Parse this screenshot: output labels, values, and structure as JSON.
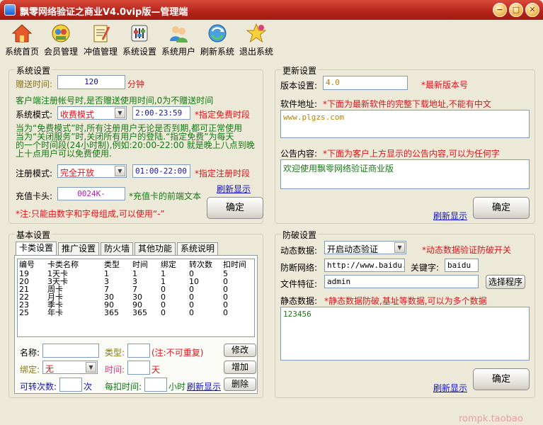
{
  "window": {
    "title": "飘零网络验证之商业V4.0vip版—管理端",
    "btn_min": "−",
    "btn_max": "□",
    "btn_close": "✕"
  },
  "toolbar": [
    {
      "label": "系统首页",
      "icon": "home-icon"
    },
    {
      "label": "会员管理",
      "icon": "members-icon"
    },
    {
      "label": "冲值管理",
      "icon": "recharge-icon"
    },
    {
      "label": "系统设置",
      "icon": "settings-icon"
    },
    {
      "label": "系统用户",
      "icon": "users-icon"
    },
    {
      "label": "刷新系统",
      "icon": "refresh-icon"
    },
    {
      "label": "退出系统",
      "icon": "exit-icon"
    }
  ],
  "system_settings": {
    "title": "系统设置",
    "gift_time_label": "赠送时间:",
    "gift_time_value": "120",
    "gift_time_unit": "分钟",
    "gift_hint": "客户端注册帐号时,是否赠送使用时间,0为不赠送时间",
    "mode_label": "系统模式:",
    "mode_value": "收费模式",
    "free_period_value": "2:00-23:59",
    "free_period_hint": "*指定免费时段",
    "mode_desc_1": "当为“免费模式”时,所有注册用户无论是否到期,都可正常使用",
    "mode_desc_2": "当为“关闭服务”时,关闭所有用户的登陆.“指定免费”为每天",
    "mode_desc_3": "的一个时间段(24小时制),例如:20:00-22:00 就是晚上八点到晚",
    "mode_desc_4": "上十点用户可以免费使用.",
    "reg_mode_label": "注册模式:",
    "reg_mode_value": "完全开放",
    "reg_period_value": "01:00-22:00",
    "reg_period_hint": "*指定注册时段",
    "card_prefix_label": "充值卡头:",
    "card_prefix_value": "0024K-",
    "card_prefix_hint": "*充值卡的前端文本",
    "refresh_link": "刷新显示",
    "note": "*注:只能由数字和字母组成,可以使用“-”",
    "ok_button": "确定"
  },
  "update_settings": {
    "title": "更新设置",
    "version_label": "版本设置:",
    "version_value": "4.0",
    "version_hint": "*最新版本号",
    "url_label": "软件地址:",
    "url_hint": "*下面为最新软件的完整下载地址,不能有中文",
    "url_value": "www.plgzs.com",
    "notice_label": "公告内容:",
    "notice_hint": "*下面为客户上方显示的公告内容,可以为任何字",
    "notice_value": "欢迎使用飘零网络验证商业版",
    "refresh_link": "刷新显示",
    "ok_button": "确定"
  },
  "basic_settings": {
    "title": "基本设置",
    "tabs": [
      "卡类设置",
      "推广设置",
      "防火墙",
      "其他功能",
      "系统说明"
    ],
    "table": {
      "headers": [
        "编号",
        "卡类名称",
        "类型",
        "时间",
        "绑定",
        "转次数",
        "扣时间"
      ],
      "rows": [
        [
          "19",
          "1天卡",
          "1",
          "1",
          "1",
          "0",
          "5"
        ],
        [
          "20",
          "3天卡",
          "3",
          "3",
          "1",
          "10",
          "0"
        ],
        [
          "21",
          "周卡",
          "7",
          "7",
          "0",
          "0",
          "0"
        ],
        [
          "22",
          "月卡",
          "30",
          "30",
          "0",
          "0",
          "0"
        ],
        [
          "23",
          "季卡",
          "90",
          "90",
          "0",
          "0",
          "0"
        ],
        [
          "25",
          "年卡",
          "365",
          "365",
          "0",
          "0",
          "0"
        ]
      ]
    },
    "name_label": "名称:",
    "type_label": "类型:",
    "type_note": "(注:不可重复)",
    "modify_button": "修改",
    "bind_label": "绑定:",
    "bind_value": "无",
    "time_label": "时间:",
    "time_unit": "天",
    "add_button": "增加",
    "transfer_label": "可转次数:",
    "transfer_unit": "次",
    "deduct_label": "每扣时间:",
    "deduct_unit": "小时",
    "refresh_link": "刷新显示",
    "delete_button": "删除"
  },
  "anti_crack": {
    "title": "防破设置",
    "dynamic_label": "动态数据:",
    "dynamic_value": "开启动态验证",
    "dynamic_hint": "*动态数据验证防破开关",
    "network_label": "防断网络:",
    "network_value": "http://www.baidu.com",
    "keyword_label": "关键字:",
    "keyword_value": "baidu",
    "file_label": "文件特征:",
    "file_value": "admin",
    "choose_button": "选择程序",
    "static_label": "静态数据:",
    "static_hint": "*静态数据防破,基址等数据,可以为多个数据",
    "static_value": "123456",
    "refresh_link": "刷新显示",
    "ok_button": "确定"
  },
  "watermark": "rompk.taobao"
}
